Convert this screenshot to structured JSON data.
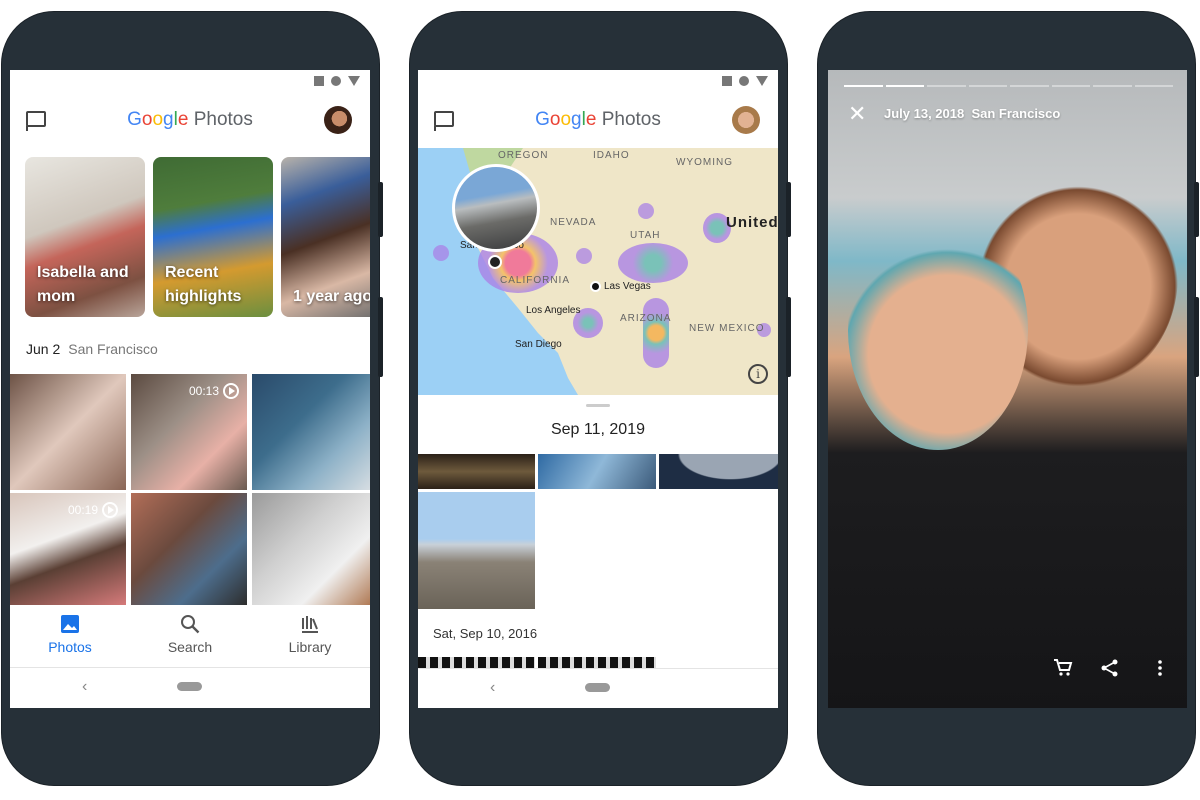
{
  "phone1": {
    "app_title": {
      "google": "Google",
      "photos": "Photos"
    },
    "memories": [
      {
        "label": "Isabella and mom"
      },
      {
        "label": "Recent highlights"
      },
      {
        "label": "1 year ago"
      }
    ],
    "date_header": {
      "date": "Jun 2",
      "location": "San Francisco"
    },
    "videos": [
      {
        "duration": "00:13"
      },
      {
        "duration": "00:19"
      }
    ],
    "bottom_nav": [
      {
        "label": "Photos",
        "icon": "photo-icon",
        "active": true
      },
      {
        "label": "Search",
        "icon": "search-icon"
      },
      {
        "label": "Library",
        "icon": "library-icon"
      }
    ],
    "accent": "#1a73e8"
  },
  "phone2": {
    "app_title": {
      "google": "Google",
      "photos": "Photos"
    },
    "map": {
      "regions": [
        "OREGON",
        "IDAHO",
        "WYOMING",
        "NEVADA",
        "UTAH",
        "CALIFORNIA",
        "ARIZONA",
        "NEW MEXICO",
        "United"
      ],
      "cities": [
        "San Francisco",
        "Las Vegas",
        "Los Angeles",
        "San Diego"
      ]
    },
    "sections": [
      {
        "date": "Sep 11, 2019"
      },
      {
        "date": "Sat, Sep 10, 2016"
      }
    ]
  },
  "phone3": {
    "story": {
      "date": "July 13, 2018",
      "location": "San Francisco",
      "progress_segments": 8,
      "completed_segments": 2
    },
    "actions": [
      "cart-icon",
      "share-icon",
      "more-icon"
    ]
  }
}
